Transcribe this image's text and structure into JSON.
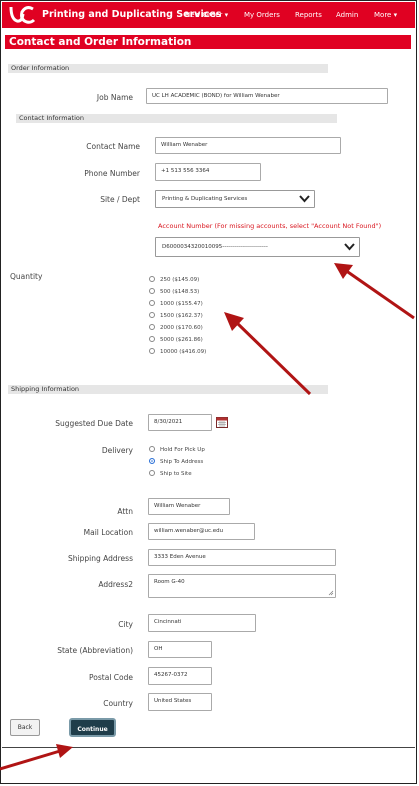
{
  "nav": {
    "brand": "Printing and Duplicating Services",
    "items": [
      "New Order ▾",
      "My Orders",
      "Reports",
      "Admin",
      "More ▾"
    ]
  },
  "page_title": "Contact and Order Information",
  "sections": {
    "order": "Order Information",
    "contact": "Contact Information",
    "shipping": "Shipping Information"
  },
  "job": {
    "label": "Job Name",
    "value": "UC LH ACADEMIC (BOND) for William Wenaber"
  },
  "contact": {
    "name_label": "Contact Name",
    "name_value": "William Wenaber",
    "phone_label": "Phone Number",
    "phone_value": "+1 513 556 3364",
    "site_label": "Site / Dept",
    "site_value": "Printing & Duplicating Services"
  },
  "account": {
    "note": "Account Number (For missing accounts, select \"Account Not Found\")",
    "value": "D6000034320010095-----------------------"
  },
  "quantity": {
    "label": "Quantity",
    "options": [
      "250 ($145.09)",
      "500 ($148.53)",
      "1000 ($155.47)",
      "1500 ($162.37)",
      "2000 ($170.60)",
      "5000 ($261.86)",
      "10000 ($416.09)"
    ]
  },
  "shipping": {
    "due_label": "Suggested Due Date",
    "due_value": "8/30/2021",
    "delivery_label": "Delivery",
    "delivery_options": [
      "Hold For Pick Up",
      "Ship To Address",
      "Ship to Site"
    ],
    "delivery_selected": 1,
    "attn_label": "Attn",
    "attn_value": "William Wenaber",
    "mail_label": "Mail Location",
    "mail_value": "william.wenaber@uc.edu",
    "addr_label": "Shipping Address",
    "addr_value": "3333 Eden Avenue",
    "addr2_label": "Address2",
    "addr2_value": "Room G-40",
    "city_label": "City",
    "city_value": "Cincinnati",
    "state_label": "State (Abbreviation)",
    "state_value": "OH",
    "postal_label": "Postal Code",
    "postal_value": "45267-0372",
    "country_label": "Country",
    "country_value": "United States"
  },
  "buttons": {
    "back": "Back",
    "continue": "Continue"
  },
  "colors": {
    "brand_red": "#e00122",
    "continue_bg": "#1f3d4a",
    "arrow_red": "#b01414"
  }
}
